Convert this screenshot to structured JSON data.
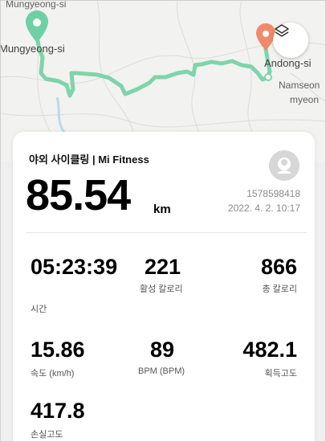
{
  "map": {
    "places": {
      "top_left": "Mungyeong-si",
      "left": "Mungyeong-si",
      "right": "Andong-si",
      "right_below_1": "Namseon",
      "right_below_2": "myeon"
    },
    "layers_icon": "layers-icon",
    "start_pin_color": "#6ED0A4",
    "end_pin_color": "#F08A6A",
    "route_color": "#7FD4AA"
  },
  "summary": {
    "title": "야외 사이클링 | Mi Fitness",
    "distance": "85.54",
    "distance_unit": "km",
    "user_id": "1578598418",
    "datetime": "2022. 4. 2. 10:17"
  },
  "stats": {
    "time": {
      "value": "05:23:39",
      "label": "시간"
    },
    "active_calories": {
      "value": "221",
      "label": "활성 칼로리"
    },
    "total_calories": {
      "value": "866",
      "label": "총 칼로리"
    },
    "speed": {
      "value": "15.86",
      "label": "속도 (km/h)"
    },
    "bpm": {
      "value": "89",
      "label": "BPM (BPM)"
    },
    "elevation_gain": {
      "value": "482.1",
      "label": "획득고도"
    },
    "elevation_loss": {
      "value": "417.8",
      "label": "손실고도"
    }
  }
}
